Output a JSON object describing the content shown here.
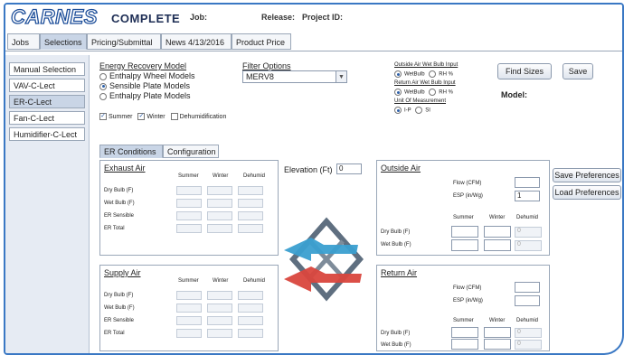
{
  "header": {
    "logo": "CARNES",
    "logo_sub": "COMPLETE",
    "job_label": "Job:",
    "release_label": "Release:",
    "project_label": "Project ID:"
  },
  "tabs": [
    {
      "label": "Jobs"
    },
    {
      "label": "Selections"
    },
    {
      "label": "Pricing/Submittal"
    },
    {
      "label": "News 4/13/2016"
    },
    {
      "label": "Product Price"
    }
  ],
  "sidebar": {
    "items": [
      {
        "label": "Manual Selection"
      },
      {
        "label": "VAV-C-Lect"
      },
      {
        "label": "ER-C-Lect"
      },
      {
        "label": "Fan-C-Lect"
      },
      {
        "label": "Humidifier-C-Lect"
      }
    ]
  },
  "model": {
    "title": "Energy Recovery Model",
    "options": [
      {
        "label": "Enthalpy Wheel Models"
      },
      {
        "label": "Sensible Plate Models"
      },
      {
        "label": "Enthalpy Plate Models"
      }
    ]
  },
  "filter": {
    "title": "Filter Options",
    "selected": "MERV8"
  },
  "outside_wetbulb": {
    "title": "Outside Air Wet Bulb Input",
    "opt1": "WetBulb",
    "opt2": "RH %"
  },
  "return_wetbulb": {
    "title": "Return Air Wet Bulb Input",
    "opt1": "WetBulb",
    "opt2": "RH %"
  },
  "units": {
    "title": "Unit Of Measurement",
    "opt1": "I-P",
    "opt2": "SI"
  },
  "season": {
    "summer": "Summer",
    "winter": "Winter",
    "dehum": "Dehumidification"
  },
  "buttons": {
    "find_sizes": "Find Sizes",
    "save": "Save",
    "save_prefs": "Save Preferences",
    "load_prefs": "Load Preferences"
  },
  "model_label": "Model:",
  "subtabs": [
    {
      "label": "ER Conditions"
    },
    {
      "label": "Configuration"
    }
  ],
  "elevation": {
    "label": "Elevation (Ft)",
    "value": "0"
  },
  "exhaust": {
    "title": "Exhaust Air",
    "cols": [
      "Summer",
      "Winter",
      "Dehumid"
    ],
    "rows": [
      "Dry Bulb (F)",
      "Wet Bulb (F)",
      "ER Sensible",
      "ER Total"
    ]
  },
  "supply": {
    "title": "Supply Air",
    "cols": [
      "Summer",
      "Winter",
      "Dehumid"
    ],
    "rows": [
      "Dry Bulb (F)",
      "Wet Bulb (F)",
      "ER Sensible",
      "ER Total"
    ]
  },
  "outside": {
    "title": "Outside Air",
    "flow_label": "Flow (CFM)",
    "esp_label": "ESP (in/Wg)",
    "esp_value": "1",
    "cols": [
      "Summer",
      "Winter",
      "Dehumid"
    ],
    "rows": [
      "Dry Bulb (F)",
      "Wet Bulb (F)"
    ],
    "dehum_placeholder": "0"
  },
  "return": {
    "title": "Return Air",
    "flow_label": "Flow (CFM)",
    "esp_label": "ESP (in/Wg)",
    "cols": [
      "Summer",
      "Winter",
      "Dehumid"
    ],
    "rows": [
      "Dry Bulb (F)",
      "Wet Bulb (F)"
    ],
    "dehum_placeholder": "0"
  },
  "colors": {
    "accent": "#2d5fa8",
    "exhaust_arrow": "#3a9fd0",
    "supply_arrow": "#d9463d",
    "core": "#6f7f8f"
  }
}
